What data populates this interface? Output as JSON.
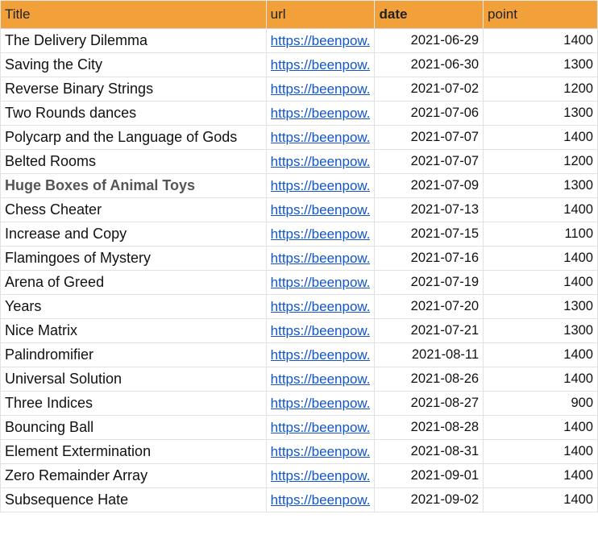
{
  "header": {
    "title": "Title",
    "url": "url",
    "date": "date",
    "point": "point"
  },
  "rows": [
    {
      "title": "The Delivery Dilemma",
      "url": "https://beenpow.",
      "date": "2021-06-29",
      "point": "1400"
    },
    {
      "title": "Saving the City",
      "url": "https://beenpow.",
      "date": "2021-06-30",
      "point": "1300"
    },
    {
      "title": "Reverse Binary Strings",
      "url": "https://beenpow.",
      "date": "2021-07-02",
      "point": "1200"
    },
    {
      "title": "Two Rounds dances",
      "url": "https://beenpow.",
      "date": "2021-07-06",
      "point": "1300"
    },
    {
      "title": "Polycarp and the Language of Gods",
      "url": "https://beenpow.",
      "date": "2021-07-07",
      "point": "1400"
    },
    {
      "title": "Belted Rooms",
      "url": "https://beenpow.",
      "date": "2021-07-07",
      "point": "1200"
    },
    {
      "title": "Huge Boxes of Animal Toys",
      "url": "https://beenpow.",
      "date": "2021-07-09",
      "point": "1300"
    },
    {
      "title": "Chess Cheater",
      "url": "https://beenpow.",
      "date": "2021-07-13",
      "point": "1400"
    },
    {
      "title": "Increase and Copy",
      "url": "https://beenpow.",
      "date": "2021-07-15",
      "point": "1100"
    },
    {
      "title": "Flamingoes of Mystery",
      "url": "https://beenpow.",
      "date": "2021-07-16",
      "point": "1400"
    },
    {
      "title": "Arena of Greed",
      "url": "https://beenpow.",
      "date": "2021-07-19",
      "point": "1400"
    },
    {
      "title": "Years",
      "url": "https://beenpow.",
      "date": "2021-07-20",
      "point": "1300"
    },
    {
      "title": "Nice Matrix",
      "url": "https://beenpow.",
      "date": "2021-07-21",
      "point": "1300"
    },
    {
      "title": "Palindromifier",
      "url": "https://beenpow.",
      "date": "2021-08-11",
      "point": "1400"
    },
    {
      "title": "Universal Solution",
      "url": "https://beenpow.",
      "date": "2021-08-26",
      "point": "1400"
    },
    {
      "title": "Three Indices",
      "url": "https://beenpow.",
      "date": "2021-08-27",
      "point": "900"
    },
    {
      "title": "Bouncing Ball",
      "url": "https://beenpow.",
      "date": "2021-08-28",
      "point": "1400"
    },
    {
      "title": "Element Extermination",
      "url": "https://beenpow.",
      "date": "2021-08-31",
      "point": "1400"
    },
    {
      "title": "Zero Remainder Array",
      "url": "https://beenpow.",
      "date": "2021-09-01",
      "point": "1400"
    },
    {
      "title": "Subsequence Hate",
      "url": "https://beenpow.",
      "date": "2021-09-02",
      "point": "1400"
    }
  ],
  "colors": {
    "header_bg": "#f1a03a",
    "link": "#1155cc",
    "grid": "#e2e2e2"
  }
}
